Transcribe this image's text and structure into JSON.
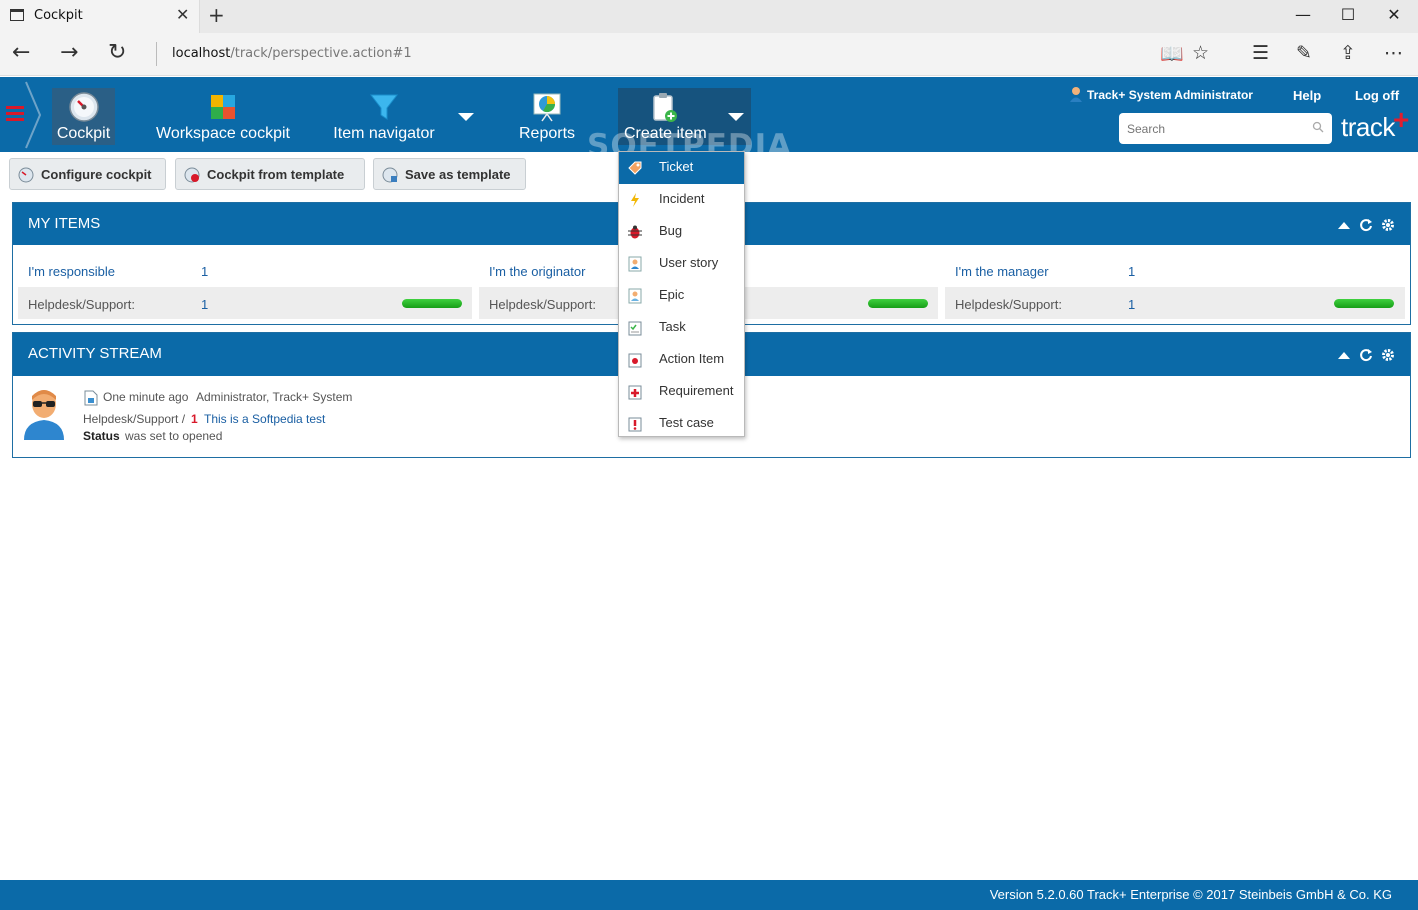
{
  "browser": {
    "tab_title": "Cockpit",
    "url_host": "localhost",
    "url_path": "/track/perspective.action#1"
  },
  "nav": {
    "items": [
      {
        "label": "Cockpit"
      },
      {
        "label": "Workspace cockpit"
      },
      {
        "label": "Item navigator"
      },
      {
        "label": "Reports"
      },
      {
        "label": "Create item"
      }
    ]
  },
  "header": {
    "user": "Track+ System Administrator",
    "help": "Help",
    "logoff": "Log off",
    "search_placeholder": "Search",
    "logo_text": "track",
    "logo_plus": "+"
  },
  "toolbar": {
    "configure": "Configure cockpit",
    "from_template": "Cockpit from template",
    "save_template": "Save as template"
  },
  "my_items": {
    "title": "MY ITEMS",
    "columns": [
      {
        "label": "I'm responsible",
        "count": "1",
        "row_label": "Helpdesk/Support:",
        "row_count": "1"
      },
      {
        "label": "I'm the originator",
        "count": "",
        "row_label": "Helpdesk/Support:",
        "row_count": ""
      },
      {
        "label": "I'm the manager",
        "count": "1",
        "row_label": "Helpdesk/Support:",
        "row_count": "1"
      }
    ]
  },
  "activity": {
    "title": "ACTIVITY STREAM",
    "time": "One minute ago",
    "actor": "Administrator, Track+ System",
    "project": "Helpdesk/Support /",
    "item_id": "1",
    "item_title": "This is a Softpedia test",
    "field": "Status",
    "change": "was set to opened"
  },
  "create_menu": {
    "items": [
      {
        "label": "Ticket",
        "selected": true
      },
      {
        "label": "Incident"
      },
      {
        "label": "Bug"
      },
      {
        "label": "User story"
      },
      {
        "label": "Epic"
      },
      {
        "label": "Task"
      },
      {
        "label": "Action Item"
      },
      {
        "label": "Requirement"
      },
      {
        "label": "Test case"
      }
    ]
  },
  "watermark": "SOFTPEDIA",
  "footer": "Version 5.2.0.60 Track+ Enterprise   © 2017 Steinbeis GmbH & Co. KG",
  "colors": {
    "brand_blue": "#0b6aa8",
    "accent_red": "#d8192a",
    "progress_green": "#22b522"
  }
}
